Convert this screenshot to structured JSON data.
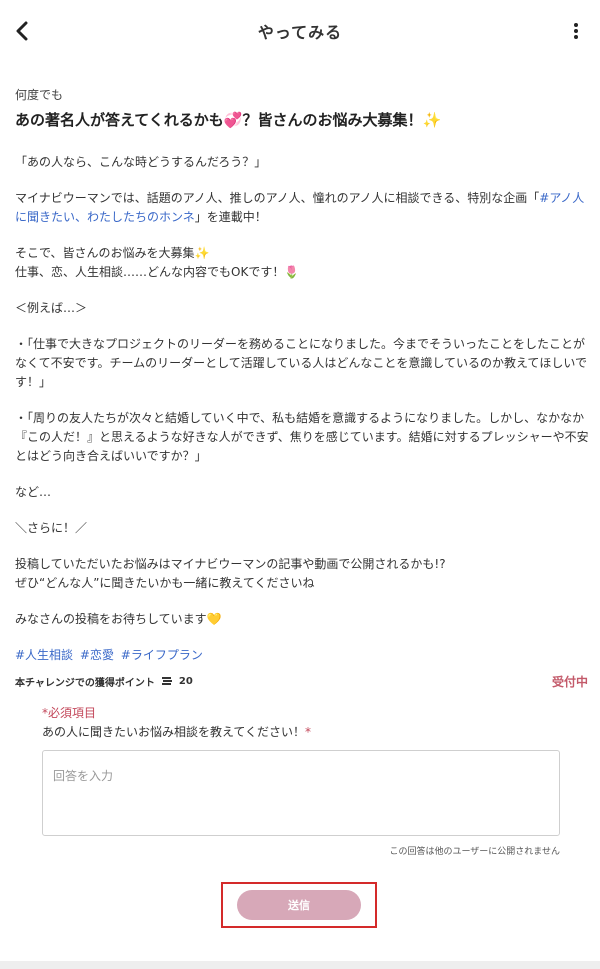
{
  "header": {
    "title": "やってみる",
    "back_icon": "chevron-left-icon",
    "more_icon": "vertical-dots-icon"
  },
  "post": {
    "category": "何度でも",
    "title": "あの著名人が答えてくれるかも💞？皆さんのお悩み大募集！✨",
    "p1": "「あの人なら、こんな時どうするんだろう？」",
    "p2_pre": "マイナビウーマンでは、話題のアノ人、推しのアノ人、憧れのアノ人に相談できる、特別な企画「",
    "p2_link": "#アノ人に聞きたい、わたしたちのホンネ",
    "p2_post": "」を連載中！",
    "p3_line1": "そこで、皆さんのお悩みを大募集✨",
    "p3_line2": "仕事、恋、人生相談……どんな内容でもOKです！🌷",
    "p4": "＜例えば…＞",
    "p5": "・「仕事で大きなプロジェクトのリーダーを務めることになりました。今までそういったことをしたことがなくて不安です。チームのリーダーとして活躍している人はどんなことを意識しているのか教えてほしいです！」",
    "p6": "・「周りの友人たちが次々と結婚していく中で、私も結婚を意識するようになりました。しかし、なかなか『この人だ！』と思えるような好きな人ができず、焦りを感じています。結婚に対するプレッシャーや不安とはどう向き合えばいいですか？」",
    "p7": "など…",
    "p8": "＼さらに！／",
    "p9_line1": "投稿していただいたお悩みはマイナビウーマンの記事や動画で公開されるかも!?",
    "p9_line2": "ぜひ“どんな人”に聞きたいかも一緒に教えてくださいね",
    "p10": "みなさんの投稿をお待ちしています💛",
    "tags": [
      "#人生相談",
      "#恋愛",
      "#ライフプラン"
    ]
  },
  "points": {
    "label": "本チャレンジでの獲得ポイント",
    "icon": "coin-stack-icon",
    "value": "20",
    "status": "受付中"
  },
  "form": {
    "required_label": "*必須項目",
    "question": "あの人に聞きたいお悩み相談を教えてください！",
    "required_mark": "*",
    "answer_value": "",
    "answer_placeholder": "回答を入力",
    "note": "この回答は他のユーザーに公開されません",
    "submit_label": "送信"
  },
  "colors": {
    "link": "#3a68c8",
    "status": "#c35a6a",
    "required": "#c3475a",
    "submit_bg": "#d7a8b8",
    "highlight_border": "#d42a2a"
  }
}
